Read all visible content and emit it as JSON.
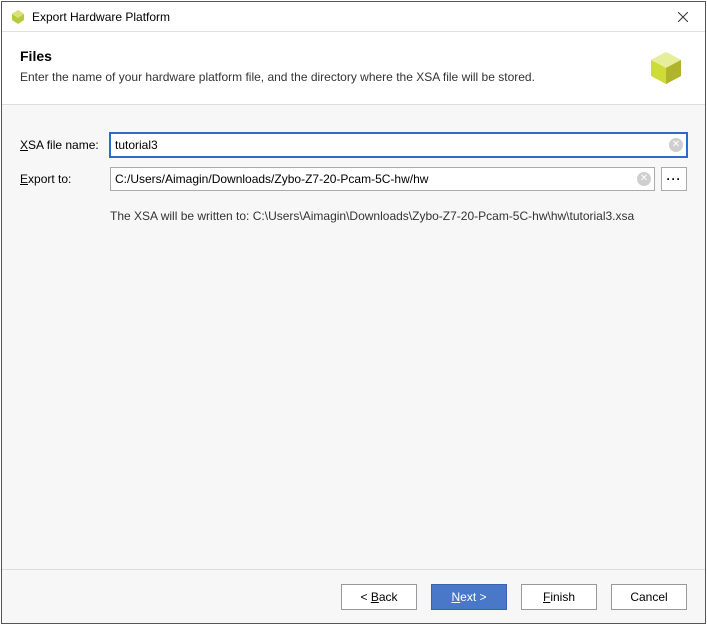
{
  "window": {
    "title": "Export Hardware Platform"
  },
  "header": {
    "heading": "Files",
    "description": "Enter the name of your hardware platform file, and the directory where the XSA file will be stored."
  },
  "form": {
    "xsa_label_pre": "X",
    "xsa_label_post": "SA file name:",
    "xsa_value": "tutorial3",
    "export_label_pre": "E",
    "export_label_post": "xport to:",
    "export_value": "C:/Users/Aimagin/Downloads/Zybo-Z7-20-Pcam-5C-hw/hw",
    "browse_glyph": "···",
    "info_text": "The XSA will be written to: C:\\Users\\Aimagin\\Downloads\\Zybo-Z7-20-Pcam-5C-hw\\hw\\tutorial3.xsa"
  },
  "footer": {
    "back_pre": "< ",
    "back_ul": "B",
    "back_post": "ack",
    "next_ul": "N",
    "next_post": "ext >",
    "finish_ul": "F",
    "finish_post": "inish",
    "cancel": "Cancel"
  }
}
